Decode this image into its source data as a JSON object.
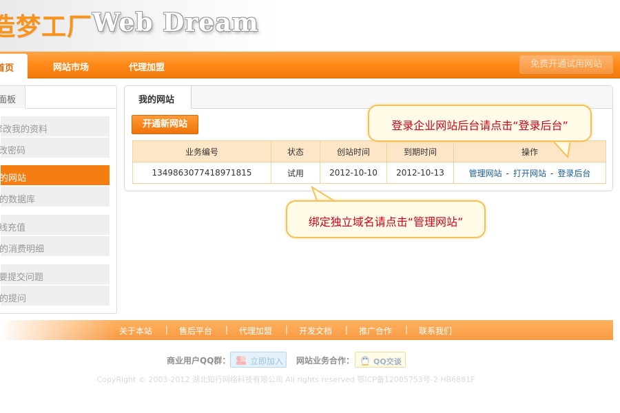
{
  "header": {
    "logo_cn": "造梦工厂",
    "logo_en": "Web Dream"
  },
  "nav": {
    "home": "首页",
    "items": [
      "网站市场",
      "代理加盟"
    ],
    "trial_button": "免费开通试用网站"
  },
  "sidebar": {
    "tab": "面板",
    "items": [
      "修改我的资料",
      "修改密码",
      "我的网站",
      "我的数据库",
      "在线充值",
      "我的消费明细",
      "我要提交问题",
      "我的提问"
    ],
    "active": "我的网站"
  },
  "panel": {
    "tab": "我的网站",
    "open_button": "开通新网站",
    "table": {
      "headers": [
        "业务编号",
        "状态",
        "创站时间",
        "到期时间",
        "操作"
      ],
      "rows": [
        {
          "id": "1349863077418971815",
          "status": "试用",
          "created": "2012-10-10",
          "expires": "2012-10-13",
          "actions": [
            "管理网站",
            "打开网站",
            "登录后台"
          ]
        }
      ]
    }
  },
  "callouts": {
    "login": "登录企业网站后台请点击“登录后台”",
    "bind": "绑定独立域名请点击“管理网站”"
  },
  "footer": {
    "links": [
      "关于本站",
      "售后平台",
      "代理加盟",
      "开发文档",
      "推广合作",
      "联系我们"
    ],
    "separator": "|",
    "qq_group_label": "商业用户QQ群：",
    "qq_join": "立即加入",
    "cooperation_label": "网站业务合作：",
    "qq_talk": "QQ交谈",
    "copyright": "CopyRight © 2003-2012 湖北知行网络科技有限公司 All rights reserved 鄂ICP备12005753号-2 HB6881F"
  },
  "colors": {
    "accent": "#f57d12",
    "link": "#1a5e9a",
    "callout_text": "#d0021b"
  }
}
